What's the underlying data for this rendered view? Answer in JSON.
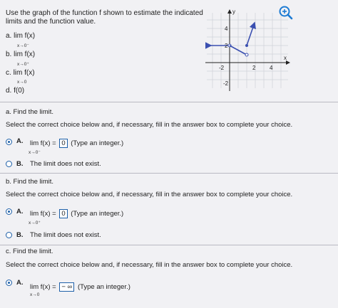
{
  "problem": {
    "line1": "Use the graph of the function f shown to estimate the indicated",
    "line2": "limits and the function value.",
    "parts": [
      {
        "label": "a.",
        "expr": "lim  f(x)",
        "sub": "x→0⁻"
      },
      {
        "label": "b.",
        "expr": "lim  f(x)",
        "sub": "x→0⁺"
      },
      {
        "label": "c.",
        "expr": "lim  f(x)",
        "sub": "x→0"
      },
      {
        "label": "d.",
        "expr": "f(0)",
        "sub": ""
      }
    ]
  },
  "graph": {
    "y_axis_label": "y",
    "x_axis_label": "x",
    "tick_labels": {
      "x_neg2": "-2",
      "x2": "2",
      "x4": "4",
      "y4": "4",
      "y2": "2",
      "y_neg2": "-2"
    }
  },
  "sections": [
    {
      "title": "a. Find the limit.",
      "instruction": "Select the correct choice below and, if necessary, fill in the answer box to complete your choice.",
      "choice_a_letter": "A.",
      "choice_a_prefix": "lim  f(x) =",
      "choice_a_answer": "0",
      "choice_a_suffix": "(Type an integer.)",
      "choice_a_sub": "x→0⁻",
      "choice_b_letter": "B.",
      "choice_b_text": "The limit does not exist."
    },
    {
      "title": "b. Find the limit.",
      "instruction": "Select the correct choice below and, if necessary, fill in the answer box to complete your choice.",
      "choice_a_letter": "A.",
      "choice_a_prefix": "lim  f(x) =",
      "choice_a_answer": "0",
      "choice_a_suffix": "(Type an integer.)",
      "choice_a_sub": "x→0⁺",
      "choice_b_letter": "B.",
      "choice_b_text": "The limit does not exist."
    },
    {
      "title": "c. Find the limit.",
      "instruction": "Select the correct choice below and, if necessary, fill in the answer box to complete your choice.",
      "choice_a_letter": "A.",
      "choice_a_prefix": "lim  f(x) =",
      "choice_a_answer": "− ∞",
      "choice_a_suffix": "(Type an integer.)",
      "choice_a_sub": "x→0"
    }
  ],
  "colors": {
    "accent": "#1d5fa8",
    "graph_line": "#3a4fb0"
  }
}
